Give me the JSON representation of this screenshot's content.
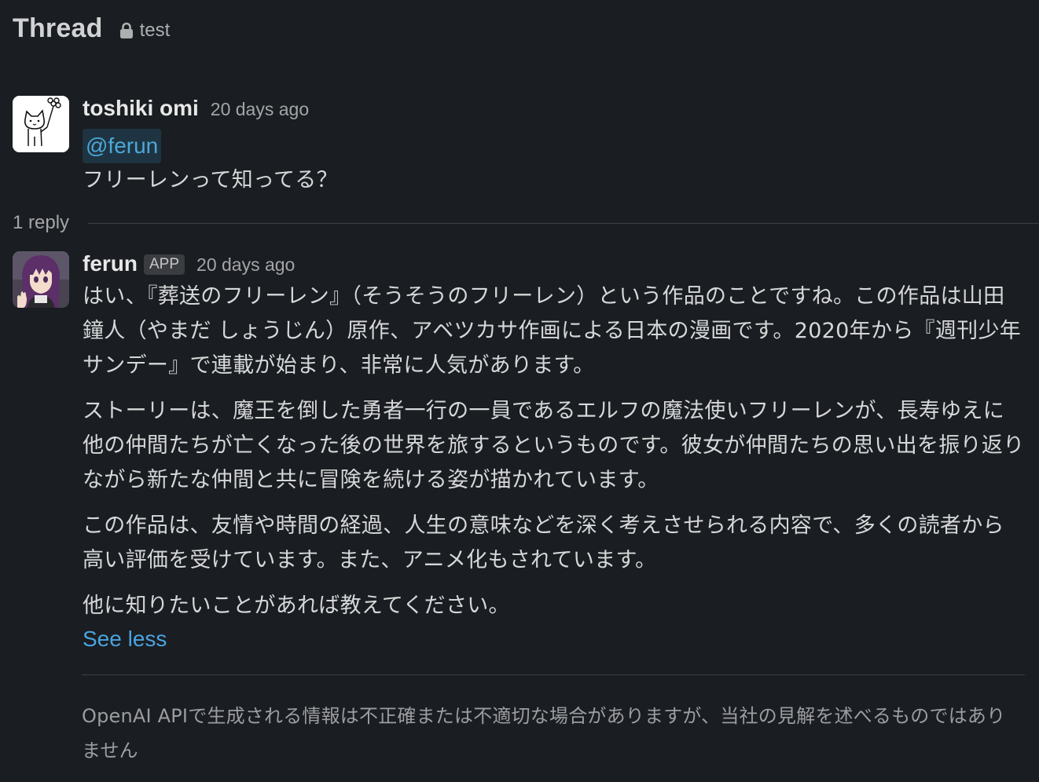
{
  "header": {
    "title": "Thread",
    "channel_icon": "lock-icon",
    "channel_name": "test"
  },
  "messages": [
    {
      "author": "toshiki omi",
      "timestamp": "20 days ago",
      "mention": "@ferun",
      "text": "フリーレンって知ってる？"
    }
  ],
  "reply_count": "1 reply",
  "reply": {
    "author": "ferun",
    "badge": "APP",
    "timestamp": "20 days ago",
    "paragraphs": [
      "はい、『葬送のフリーレン』（そうそうのフリーレン）という作品のことですね。この作品は山田鐘人（やまだ しょうじん）原作、アベツカサ作画による日本の漫画です。2020年から『週刊少年サンデー』で連載が始まり、非常に人気があります。",
      "ストーリーは、魔王を倒した勇者一行の一員であるエルフの魔法使いフリーレンが、長寿ゆえに他の仲間たちが亡くなった後の世界を旅するというものです。彼女が仲間たちの思い出を振り返りながら新たな仲間と共に冒険を続ける姿が描かれています。",
      "この作品は、友情や時間の経過、人生の意味などを深く考えさせられる内容で、多くの読者から高い評価を受けています。また、アニメ化もされています。",
      "他に知りたいことがあれば教えてください。"
    ],
    "see_less": "See less",
    "disclaimer": "OpenAI APIで生成される情報は不正確または不適切な場合がありますが、当社の見解を述べるものではありません"
  },
  "colors": {
    "background": "#1a1d21",
    "link": "#4aa3df",
    "mention_bg": "#1f3442"
  }
}
